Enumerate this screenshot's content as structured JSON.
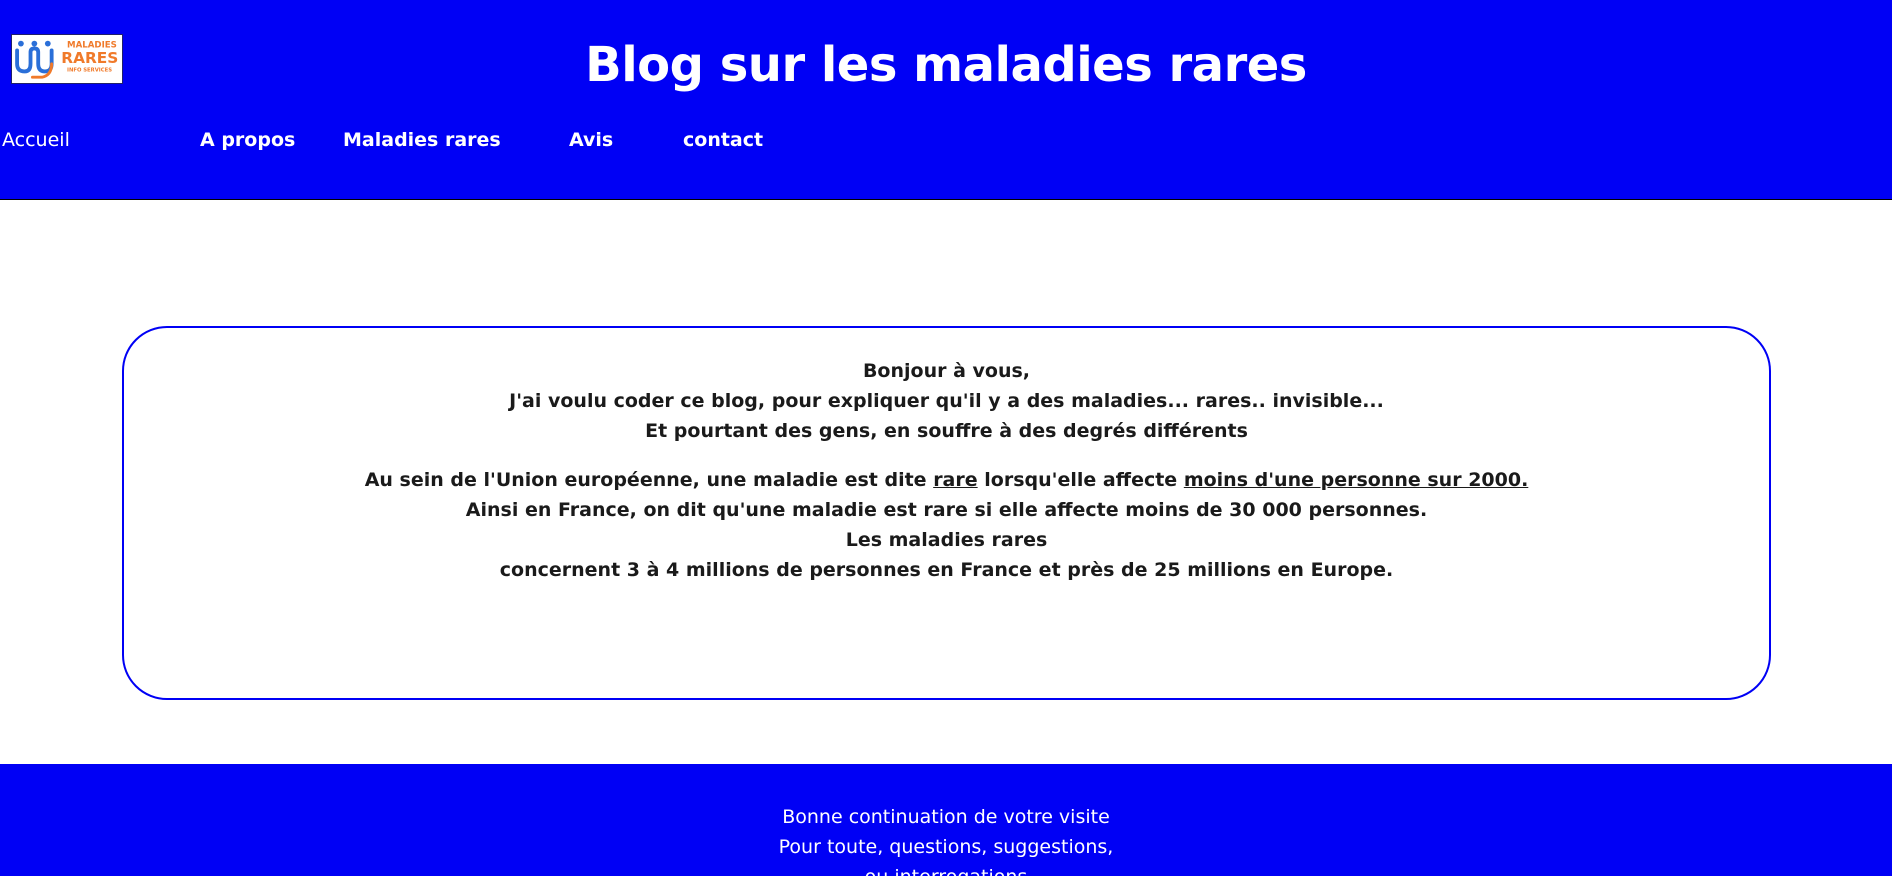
{
  "header": {
    "logo": {
      "text_line1": "MALADIES",
      "text_line2": "RARES",
      "text_line3": "INFO SERVICES",
      "icon": "maladies-rares-logo-icon"
    },
    "title": "Blog sur les maladies rares",
    "nav": [
      {
        "label": "Accueil"
      },
      {
        "label": "A propos"
      },
      {
        "label": "Maladies rares"
      },
      {
        "label": "Avis"
      },
      {
        "label": "contact"
      }
    ]
  },
  "main": {
    "intro": [
      "Bonjour à vous,",
      "J'ai voulu coder ce blog, pour expliquer qu'il y a des maladies... rares.. invisible...",
      "Et pourtant des gens, en souffre à des degrés différents"
    ],
    "para": {
      "line1_a": "Au sein de l'Union européenne, une maladie est dite ",
      "line1_u1": "rare",
      "line1_b": " lorsqu'elle affecte ",
      "line1_u2": "moins d'une personne sur 2000.",
      "line2": "Ainsi en France, on dit qu'une maladie est rare si elle affecte moins de 30 000 personnes.",
      "line3": "Les maladies rares",
      "line4": "concernent 3 à 4 millions de personnes en France et près de 25 millions en Europe."
    }
  },
  "footer": {
    "lines": [
      "Bonne continuation de votre visite",
      "Pour toute, questions, suggestions,",
      "ou interrogations"
    ]
  },
  "colors": {
    "brand_blue": "#0000f5",
    "text_dark": "#1a1a1a",
    "logo_orange": "#f07a2a",
    "logo_blue": "#2a6fd8"
  }
}
